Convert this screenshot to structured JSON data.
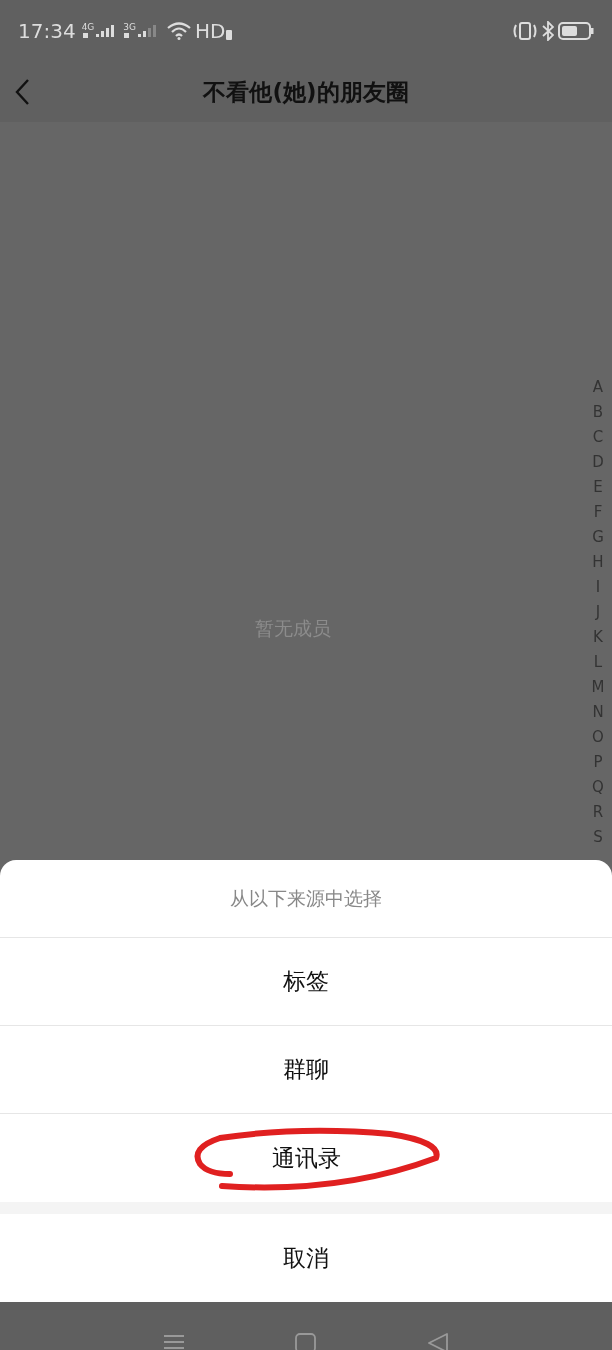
{
  "status_bar": {
    "time": "17:34",
    "signals": [
      {
        "label": "4G"
      },
      {
        "label": "3G"
      }
    ],
    "hd": "HD"
  },
  "header": {
    "title": "不看他(她)的朋友圈"
  },
  "empty_text": "暂无成员",
  "index_letters": [
    "A",
    "B",
    "C",
    "D",
    "E",
    "F",
    "G",
    "H",
    "I",
    "J",
    "K",
    "L",
    "M",
    "N",
    "O",
    "P",
    "Q",
    "R",
    "S"
  ],
  "action_sheet": {
    "title": "从以下来源中选择",
    "options": [
      {
        "label": "标签",
        "circled": false
      },
      {
        "label": "群聊",
        "circled": false
      },
      {
        "label": "通讯录",
        "circled": true
      }
    ],
    "cancel": "取消"
  }
}
